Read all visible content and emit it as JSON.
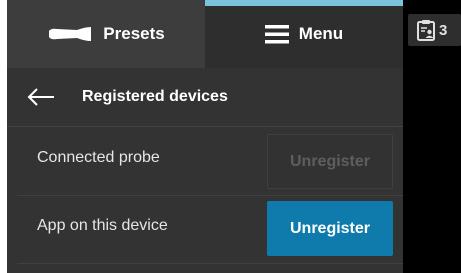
{
  "tabs": {
    "presets_label": "Presets",
    "menu_label": "Menu",
    "active": "Menu"
  },
  "header": {
    "title": "Registered devices"
  },
  "devices": [
    {
      "label": "Connected probe",
      "button_label": "Unregister",
      "button_enabled": false
    },
    {
      "label": "App on this device",
      "button_label": "Unregister",
      "button_enabled": true
    }
  ],
  "side": {
    "count": "3",
    "icon": "clipboard-user-icon"
  },
  "colors": {
    "panel_bg": "#333333",
    "accent": "#79c3dd",
    "primary_button": "#0e7bac"
  }
}
